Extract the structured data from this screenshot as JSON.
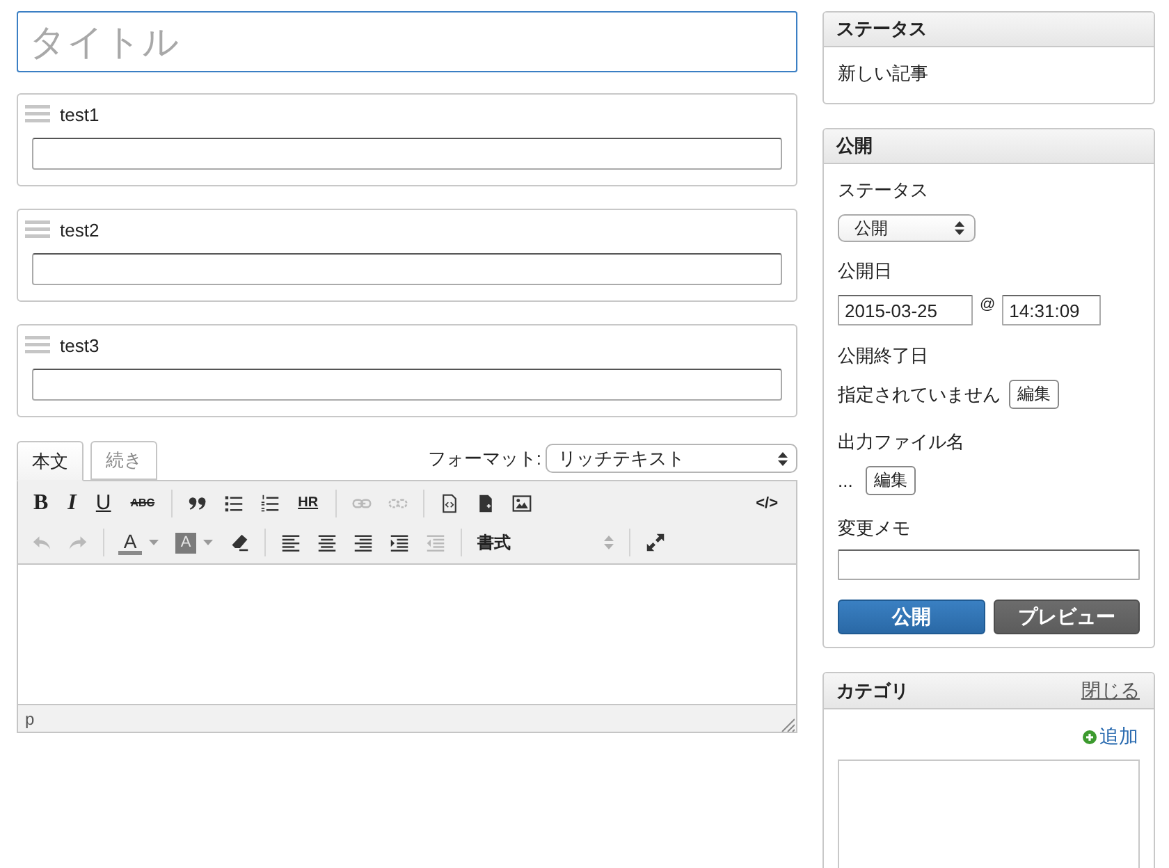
{
  "title_field": {
    "placeholder": "タイトル"
  },
  "custom_fields": [
    {
      "label": "test1"
    },
    {
      "label": "test2"
    },
    {
      "label": "test3"
    }
  ],
  "editor": {
    "tabs": [
      {
        "label": "本文",
        "selected": true
      },
      {
        "label": "続き",
        "selected": false
      }
    ],
    "format": {
      "label": "フォーマット:",
      "value": "リッチテキスト"
    },
    "toolbar": [
      {
        "groups": [
          [
            {
              "kind": "bold",
              "label": "B",
              "disabled": false
            },
            {
              "kind": "italic",
              "label": "I",
              "disabled": false
            },
            {
              "kind": "underline",
              "label": "U",
              "disabled": false
            },
            {
              "kind": "strike",
              "label": "ABC",
              "disabled": false
            }
          ],
          [
            {
              "kind": "quote",
              "disabled": false
            },
            {
              "kind": "bullets",
              "disabled": false
            },
            {
              "kind": "numbers",
              "disabled": false
            },
            {
              "kind": "rule",
              "label": "HR",
              "disabled": false
            }
          ],
          [
            {
              "kind": "link",
              "disabled": true
            },
            {
              "kind": "unlink",
              "disabled": true
            }
          ],
          [
            {
              "kind": "source",
              "disabled": false
            },
            {
              "kind": "template",
              "disabled": false
            },
            {
              "kind": "image",
              "disabled": false
            }
          ]
        ],
        "end": [
          {
            "kind": "code",
            "label": "</>",
            "disabled": false
          }
        ]
      },
      {
        "groups": [
          [
            {
              "kind": "undo",
              "disabled": true
            },
            {
              "kind": "redo",
              "disabled": true
            }
          ],
          [
            {
              "kind": "textcolor",
              "label": "A",
              "disabled": false
            },
            {
              "kind": "bgcolor",
              "label": "A",
              "disabled": false
            },
            {
              "kind": "eraser",
              "disabled": false
            }
          ],
          [
            {
              "kind": "alignleft",
              "disabled": false
            },
            {
              "kind": "aligncenter",
              "disabled": false
            },
            {
              "kind": "alignright",
              "disabled": false
            },
            {
              "kind": "indent",
              "disabled": false
            },
            {
              "kind": "outdent",
              "disabled": true
            }
          ],
          [
            {
              "kind": "select",
              "label": "書式",
              "disabled": false
            }
          ],
          [
            {
              "kind": "fullscreen",
              "disabled": false
            }
          ]
        ]
      }
    ],
    "status_bar": "p"
  },
  "sidebar": {
    "status_panel": {
      "title": "ステータス",
      "text": "新しい記事"
    },
    "publish_panel": {
      "title": "公開",
      "status": {
        "label": "ステータス",
        "value": "公開"
      },
      "publish_date": {
        "label": "公開日",
        "date": "2015-03-25",
        "separator": "@",
        "time": "14:31:09"
      },
      "end_date": {
        "label": "公開終了日",
        "value": "指定されていません",
        "button": "編集"
      },
      "output_file": {
        "label": "出力ファイル名",
        "value": "...",
        "button": "編集"
      },
      "memo": {
        "label": "変更メモ"
      },
      "buttons": [
        {
          "label": "公開",
          "kind": "primary"
        },
        {
          "label": "プレビュー",
          "kind": "secondary"
        }
      ]
    },
    "category_panel": {
      "title": "カテゴリ",
      "close_link": "閉じる",
      "add_link": "追加"
    }
  }
}
